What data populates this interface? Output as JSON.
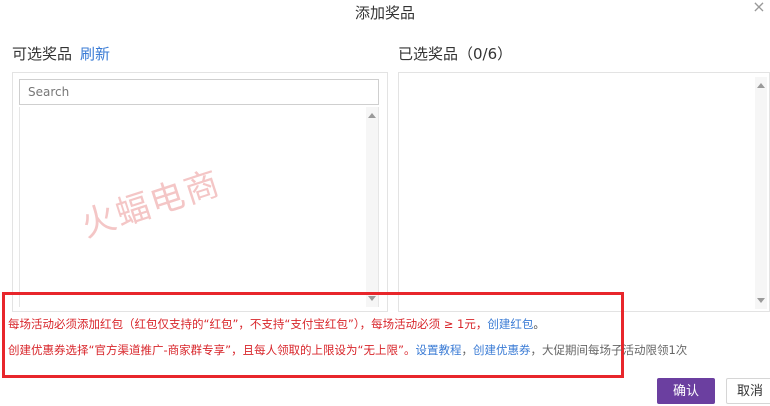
{
  "dialog": {
    "title": "添加奖品",
    "close_icon": "×"
  },
  "left": {
    "heading": "可选奖品",
    "refresh_label": "刷新",
    "search_placeholder": "Search"
  },
  "right": {
    "heading": "已选奖品（0/6）"
  },
  "watermark": "火蝠电商",
  "notice": {
    "line1": {
      "a": "每场活动必须添加红包（红包仅支持的“红包”，不支持“支付宝红包”），每场活动必须 ≥ 1元，",
      "link": "创建红包",
      "end": "。"
    },
    "line2": {
      "a": "创建优惠券选择“官方渠道推广-商家群专享”，且每人领取的上限设为“无上限”。",
      "link1": "设置教程",
      "sep": "，",
      "link2": "创建优惠券",
      "tail": "，大促期间每场子活动限领1次"
    }
  },
  "buttons": {
    "confirm": "确认",
    "cancel": "取消"
  },
  "colors": {
    "accent_blue": "#3a7bd5",
    "warning_red": "#d8262b",
    "primary_purple": "#6b3fa0"
  }
}
